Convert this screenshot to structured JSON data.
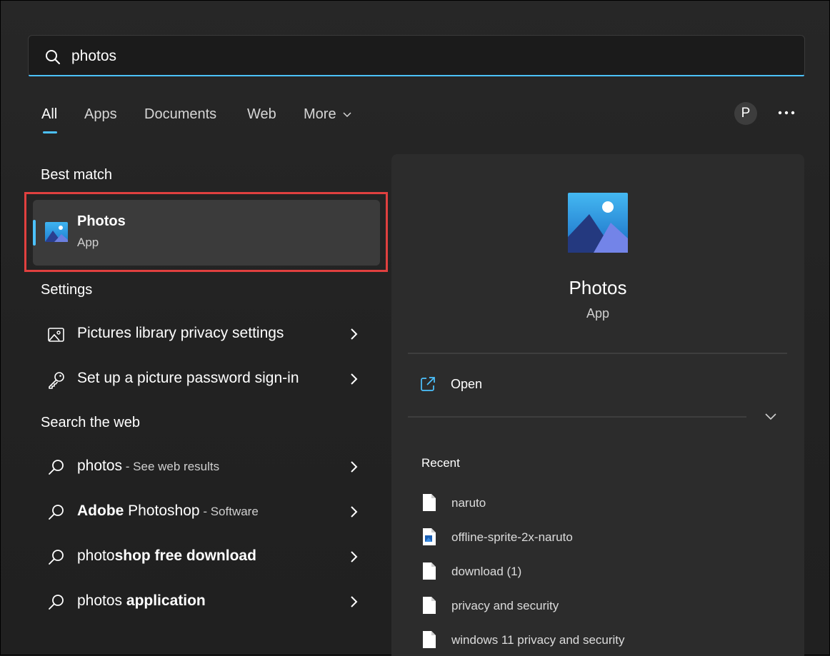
{
  "search": {
    "query": "photos"
  },
  "tabs": [
    {
      "label": "All",
      "active": true
    },
    {
      "label": "Apps"
    },
    {
      "label": "Documents"
    },
    {
      "label": "Web"
    },
    {
      "label": "More"
    }
  ],
  "account": {
    "initial": "P"
  },
  "best_match": {
    "heading": "Best match",
    "title": "Photos",
    "subtitle": "App"
  },
  "settings": {
    "heading": "Settings",
    "items": [
      {
        "label": "Pictures library privacy settings",
        "icon": "picture-icon"
      },
      {
        "label": "Set up a picture password sign-in",
        "icon": "key-icon"
      }
    ]
  },
  "web": {
    "heading": "Search the web",
    "items": [
      {
        "bold": "",
        "normal": "photos",
        "suffix": " - See web results"
      },
      {
        "bold": "Adobe",
        "normal": " Photoshop",
        "suffix": " - Software"
      },
      {
        "bold": "",
        "normal": "photo",
        "bold2": "shop free download",
        "suffix": ""
      },
      {
        "bold": "",
        "normal": "photos ",
        "bold2": "application",
        "suffix": ""
      }
    ]
  },
  "preview": {
    "title": "Photos",
    "subtitle": "App",
    "open_label": "Open",
    "recent_heading": "Recent",
    "recent": [
      {
        "name": "naruto",
        "icon": "file-icon"
      },
      {
        "name": "offline-sprite-2x-naruto",
        "icon": "image-file-icon"
      },
      {
        "name": "download (1)",
        "icon": "file-icon"
      },
      {
        "name": "privacy and security",
        "icon": "file-icon"
      },
      {
        "name": "windows 11 privacy and security",
        "icon": "file-icon"
      }
    ]
  },
  "colors": {
    "accent": "#4cc2ff",
    "highlight": "#e0403f"
  }
}
